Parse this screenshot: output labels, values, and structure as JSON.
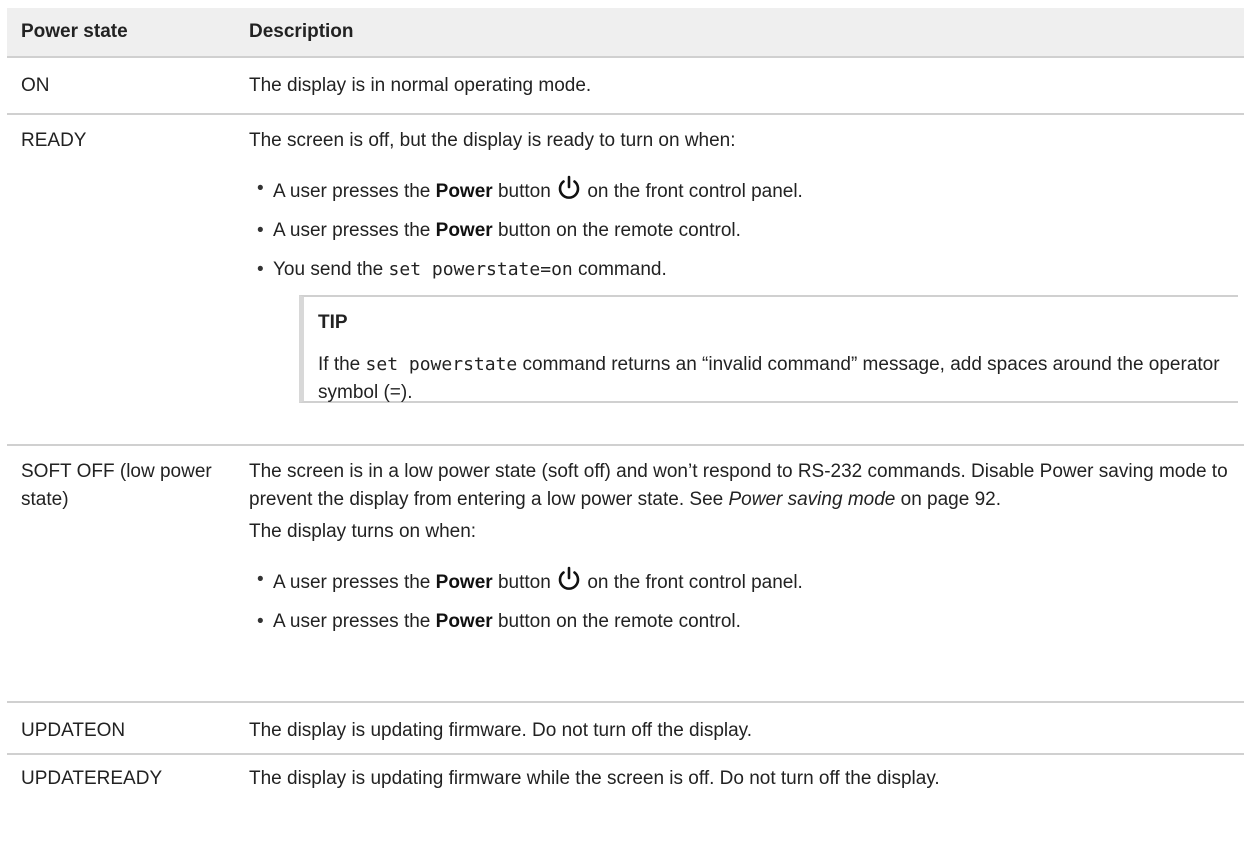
{
  "headers": {
    "col1": "Power state",
    "col2": "Description"
  },
  "rows": {
    "on": {
      "state": "ON",
      "desc": "The display is in normal operating mode."
    },
    "ready": {
      "state": "READY",
      "intro": "The screen is off, but the display is ready to turn on when:",
      "bullet1": {
        "pre": "A user presses the ",
        "bold": "Power",
        "mid": " button",
        "post": " on the front control panel."
      },
      "bullet2": {
        "pre": "A user presses the ",
        "bold": "Power",
        "post": " button on the remote control."
      },
      "bullet3": {
        "pre": "You send the ",
        "code": "set powerstate=on",
        "post": " command."
      },
      "tip": {
        "title": "TIP",
        "pre": "If the ",
        "code": "set powerstate",
        "post": " command returns an “invalid command” message, add spaces around the operator symbol (=)."
      }
    },
    "soft_off": {
      "state": "SOFT OFF (low power state)",
      "para1": "The screen is in a low power state (soft off) and won’t respond to RS-232 commands. Disable Power saving mode to prevent the display from entering a low power state. See ",
      "para1_italic": "Power saving mode",
      "para1_post": " on page 92.",
      "para2": "The display turns on when:",
      "bullet1": {
        "pre": "A user presses the ",
        "bold": "Power",
        "mid": " button",
        "post": " on the front control panel."
      },
      "bullet2": {
        "pre": "A user presses the ",
        "bold": "Power",
        "post": " button on the remote control."
      }
    },
    "updateon": {
      "state": "UPDATEON",
      "desc": "The display is updating firmware. Do not turn off the display."
    },
    "updateready": {
      "state": "UPDATEREADY",
      "desc": "The display is updating firmware while the screen is off. Do not turn off the display."
    }
  },
  "icons": {
    "power": "power-icon"
  }
}
